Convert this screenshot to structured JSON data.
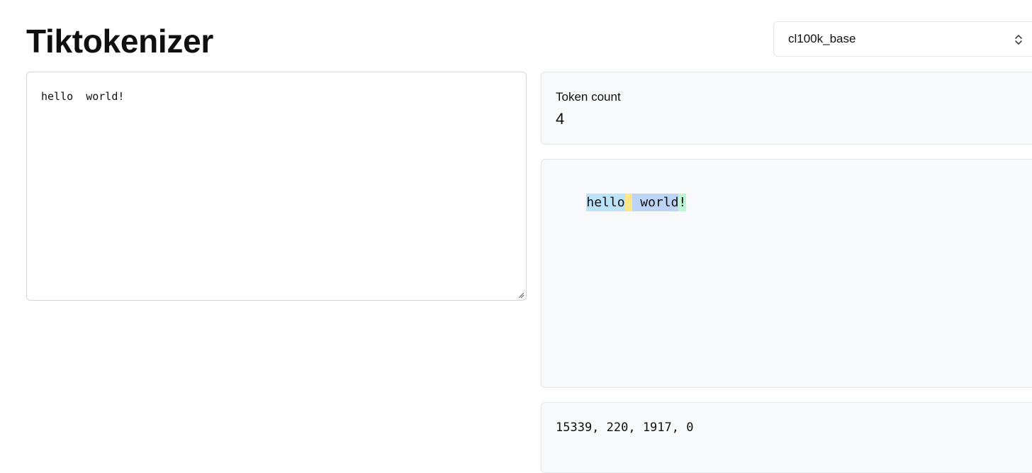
{
  "header": {
    "title": "Tiktokenizer"
  },
  "encoding_select": {
    "value": "cl100k_base",
    "icon": "chevron-up-down-icon"
  },
  "input": {
    "value": "hello  world!"
  },
  "token_count": {
    "label": "Token count",
    "value": "4"
  },
  "tokens": [
    {
      "text": "hello",
      "color": "#bde3f8"
    },
    {
      "text": " ",
      "color": "#fde68a"
    },
    {
      "text": " world",
      "color": "#bcd4f6"
    },
    {
      "text": "!",
      "color": "#bbf7d0"
    }
  ],
  "token_ids": "15339, 220, 1917, 0"
}
